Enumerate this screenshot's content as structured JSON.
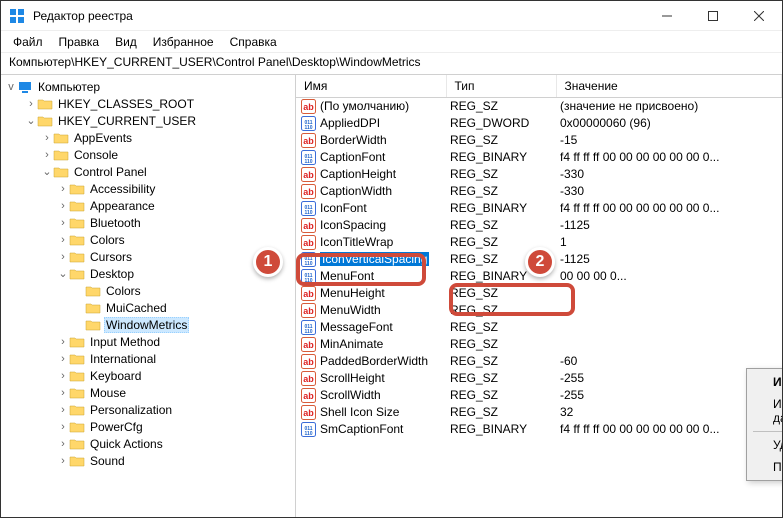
{
  "window": {
    "title": "Редактор реестра"
  },
  "menu": {
    "file": "Файл",
    "edit": "Правка",
    "view": "Вид",
    "fav": "Избранное",
    "help": "Справка"
  },
  "address": "Компьютер\\HKEY_CURRENT_USER\\Control Panel\\Desktop\\WindowMetrics",
  "tree": {
    "root": "Компьютер",
    "nodes": [
      {
        "d": 1,
        "e": ">",
        "t": "HKEY_CLASSES_ROOT"
      },
      {
        "d": 1,
        "e": "v",
        "t": "HKEY_CURRENT_USER"
      },
      {
        "d": 2,
        "e": ">",
        "t": "AppEvents"
      },
      {
        "d": 2,
        "e": ">",
        "t": "Console"
      },
      {
        "d": 2,
        "e": "v",
        "t": "Control Panel"
      },
      {
        "d": 3,
        "e": ">",
        "t": "Accessibility"
      },
      {
        "d": 3,
        "e": ">",
        "t": "Appearance"
      },
      {
        "d": 3,
        "e": ">",
        "t": "Bluetooth"
      },
      {
        "d": 3,
        "e": ">",
        "t": "Colors"
      },
      {
        "d": 3,
        "e": ">",
        "t": "Cursors"
      },
      {
        "d": 3,
        "e": "v",
        "t": "Desktop"
      },
      {
        "d": 4,
        "e": "",
        "t": "Colors"
      },
      {
        "d": 4,
        "e": "",
        "t": "MuiCached"
      },
      {
        "d": 4,
        "e": "",
        "t": "WindowMetrics",
        "sel": true
      },
      {
        "d": 3,
        "e": ">",
        "t": "Input Method"
      },
      {
        "d": 3,
        "e": ">",
        "t": "International"
      },
      {
        "d": 3,
        "e": ">",
        "t": "Keyboard"
      },
      {
        "d": 3,
        "e": ">",
        "t": "Mouse"
      },
      {
        "d": 3,
        "e": ">",
        "t": "Personalization"
      },
      {
        "d": 3,
        "e": ">",
        "t": "PowerCfg"
      },
      {
        "d": 3,
        "e": ">",
        "t": "Quick Actions"
      },
      {
        "d": 3,
        "e": ">",
        "t": "Sound"
      }
    ]
  },
  "listHeaders": {
    "name": "Имя",
    "type": "Тип",
    "value": "Значение"
  },
  "values": [
    {
      "i": "s",
      "n": "(По умолчанию)",
      "t": "REG_SZ",
      "v": "(значение не присвоено)"
    },
    {
      "i": "b",
      "n": "AppliedDPI",
      "t": "REG_DWORD",
      "v": "0x00000060 (96)"
    },
    {
      "i": "s",
      "n": "BorderWidth",
      "t": "REG_SZ",
      "v": "-15"
    },
    {
      "i": "b",
      "n": "CaptionFont",
      "t": "REG_BINARY",
      "v": "f4 ff ff ff 00 00 00 00 00 00 0..."
    },
    {
      "i": "s",
      "n": "CaptionHeight",
      "t": "REG_SZ",
      "v": "-330"
    },
    {
      "i": "s",
      "n": "CaptionWidth",
      "t": "REG_SZ",
      "v": "-330"
    },
    {
      "i": "b",
      "n": "IconFont",
      "t": "REG_BINARY",
      "v": "f4 ff ff ff 00 00 00 00 00 00 0..."
    },
    {
      "i": "s",
      "n": "IconSpacing",
      "t": "REG_SZ",
      "v": "-1125"
    },
    {
      "i": "s",
      "n": "IconTitleWrap",
      "t": "REG_SZ",
      "v": "1"
    },
    {
      "i": "b",
      "n": "IconVerticalSpacing",
      "t": "REG_SZ",
      "v": "-1125",
      "sel": true
    },
    {
      "i": "b",
      "n": "MenuFont",
      "t": "REG_BINARY",
      "v": "00 00 00 0..."
    },
    {
      "i": "s",
      "n": "MenuHeight",
      "t": "REG_SZ",
      "v": ""
    },
    {
      "i": "s",
      "n": "MenuWidth",
      "t": "REG_SZ",
      "v": ""
    },
    {
      "i": "b",
      "n": "MessageFont",
      "t": "REG_SZ",
      "v": ""
    },
    {
      "i": "s",
      "n": "MinAnimate",
      "t": "REG_SZ",
      "v": ""
    },
    {
      "i": "s",
      "n": "PaddedBorderWidth",
      "t": "REG_SZ",
      "v": "-60"
    },
    {
      "i": "s",
      "n": "ScrollHeight",
      "t": "REG_SZ",
      "v": "-255"
    },
    {
      "i": "s",
      "n": "ScrollWidth",
      "t": "REG_SZ",
      "v": "-255"
    },
    {
      "i": "s",
      "n": "Shell Icon Size",
      "t": "REG_SZ",
      "v": "32"
    },
    {
      "i": "b",
      "n": "SmCaptionFont",
      "t": "REG_BINARY",
      "v": "f4 ff ff ff 00 00 00 00 00 00 0..."
    }
  ],
  "context": {
    "modify": "Изменить...",
    "modifyBin": "Изменить двоичные данные...",
    "delete": "Удалить",
    "rename": "Переименовать"
  },
  "badges": {
    "b1": "1",
    "b2": "2"
  }
}
